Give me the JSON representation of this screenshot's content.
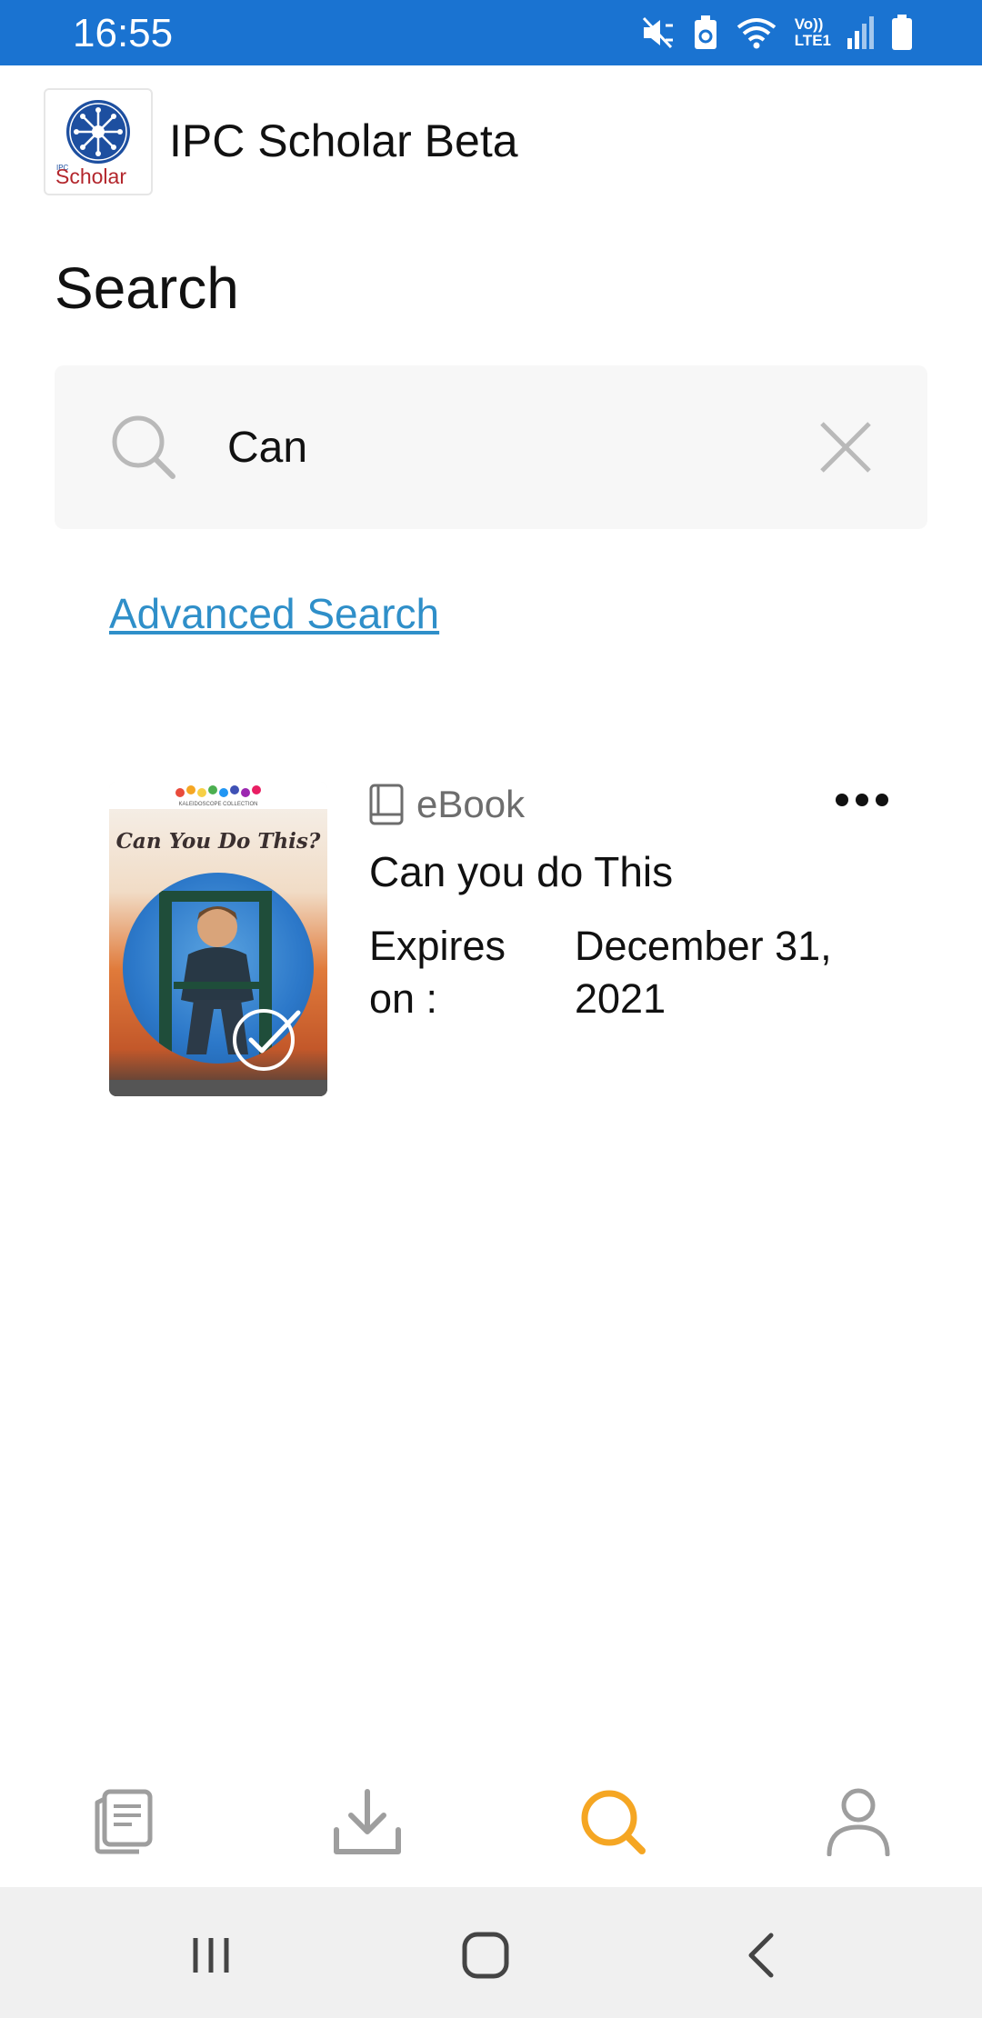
{
  "status_bar": {
    "time": "16:55",
    "lte_top": "Vo))",
    "lte_bottom": "LTE1",
    "icons": [
      "mute-icon",
      "battery-saver-icon",
      "wifi-icon",
      "signal-icon",
      "battery-icon"
    ]
  },
  "app": {
    "title": "IPC Scholar Beta",
    "logo_small": "IPC",
    "logo_text": "Scholar",
    "logo_color": "#b3262c"
  },
  "page": {
    "title": "Search"
  },
  "search": {
    "value": "Can",
    "icon": "search-icon",
    "clear_icon": "close-icon"
  },
  "advanced_search": {
    "label": "Advanced Search",
    "color": "#2f8fc9"
  },
  "results": [
    {
      "type": "eBook",
      "title": "Can you do This",
      "expires_label": "Expires on :",
      "expires_value": "December 31, 2021",
      "cover_title": "Can You Do This?",
      "cover_caption": "KALEIDOSCOPE COLLECTION"
    }
  ],
  "bottom_nav": {
    "items": [
      "library-icon",
      "download-icon",
      "search-icon",
      "profile-icon"
    ],
    "active": "search-icon",
    "active_color": "#f5a623",
    "inactive_color": "#9e9e9e"
  },
  "system_nav": {
    "items": [
      "recent-apps-icon",
      "home-icon",
      "back-icon"
    ]
  },
  "colors": {
    "status_bar": "#1a73d1",
    "search_bg": "#f7f7f7"
  }
}
